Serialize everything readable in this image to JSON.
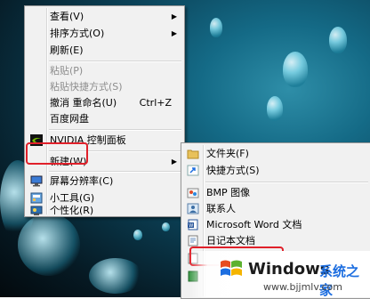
{
  "context_menu": {
    "items": [
      {
        "label": "查看(V)",
        "arrow": "▶"
      },
      {
        "label": "排序方式(O)",
        "arrow": "▶"
      },
      {
        "label": "刷新(E)"
      },
      {
        "label": "粘贴(P)"
      },
      {
        "label": "粘贴快捷方式(S)"
      },
      {
        "label": "撤消 重命名(U)",
        "accel": "Ctrl+Z"
      },
      {
        "label": "百度网盘"
      },
      {
        "label": "NVIDIA 控制面板"
      },
      {
        "label": "新建(W)",
        "arrow": "▶"
      },
      {
        "label": "屏幕分辨率(C)"
      },
      {
        "label": "小工具(G)"
      },
      {
        "label": "个性化(R)"
      }
    ]
  },
  "submenu": {
    "items": [
      {
        "label": "文件夹(F)"
      },
      {
        "label": "快捷方式(S)"
      },
      {
        "label": "BMP 图像"
      },
      {
        "label": "联系人"
      },
      {
        "label": "Microsoft Word 文档"
      },
      {
        "label": "日记本文档"
      }
    ]
  },
  "watermark": {
    "brand": "Windows",
    "suffix": "系统之家",
    "url": "www.bjjmlv.com"
  },
  "colors": {
    "highlight_box": "#e0202a",
    "menu_bg": "#f1f1f1",
    "brand_blue": "#1d6ee0"
  }
}
